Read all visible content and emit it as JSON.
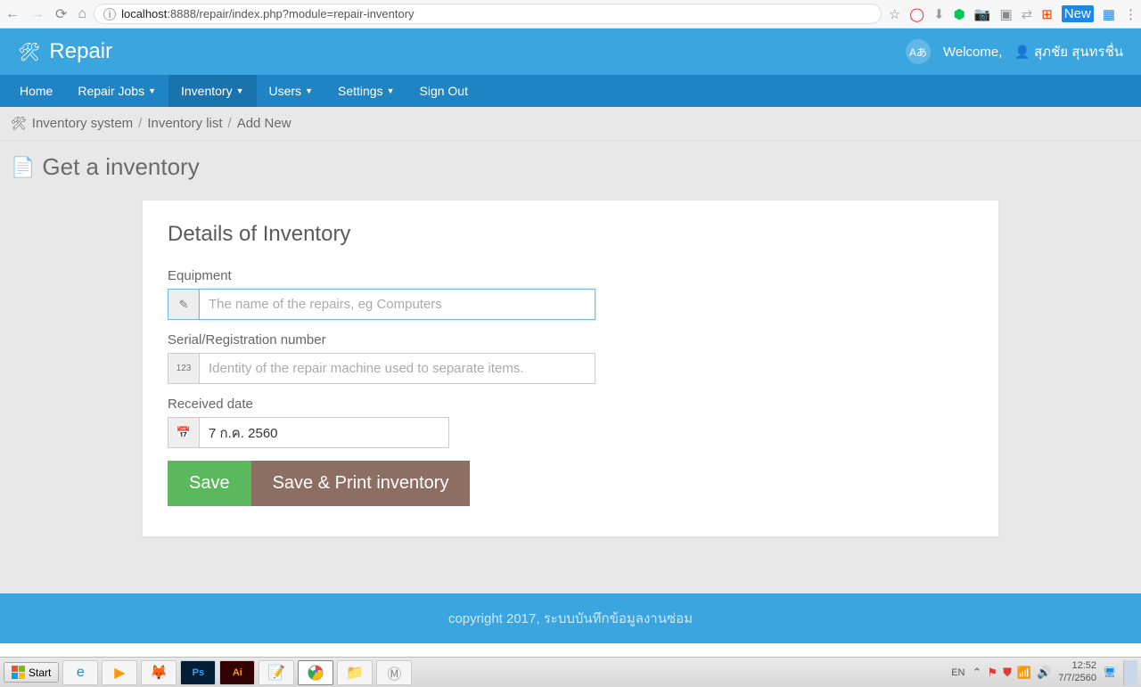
{
  "browser": {
    "url_host": "localhost",
    "url_port": ":8888",
    "url_path": "/repair/index.php?module=repair-inventory",
    "new_badge": "New"
  },
  "app": {
    "brand": "Repair",
    "welcome": "Welcome,",
    "username": "สุภชัย สุนทรชื่น",
    "lang_badge": "Aあ"
  },
  "menu": {
    "home": "Home",
    "repair_jobs": "Repair Jobs",
    "inventory": "Inventory",
    "users": "Users",
    "settings": "Settings",
    "signout": "Sign Out"
  },
  "breadcrumb": {
    "a": "Inventory system",
    "b": "Inventory list",
    "c": "Add New"
  },
  "page_title": "Get a inventory",
  "card": {
    "heading": "Details of Inventory",
    "equipment_label": "Equipment",
    "equipment_placeholder": "The name of the repairs, eg Computers",
    "serial_label": "Serial/Registration number",
    "serial_placeholder": "Identity of the repair machine used to separate items.",
    "date_label": "Received date",
    "date_value": "7 ก.ค. 2560",
    "serial_addon": "123",
    "btn_save": "Save",
    "btn_print": "Save & Print inventory"
  },
  "footer": "copyright 2017, ระบบบันทึกข้อมูลงานซ่อม",
  "taskbar": {
    "start": "Start",
    "lang": "EN",
    "time": "12:52",
    "date": "7/7/2560"
  }
}
